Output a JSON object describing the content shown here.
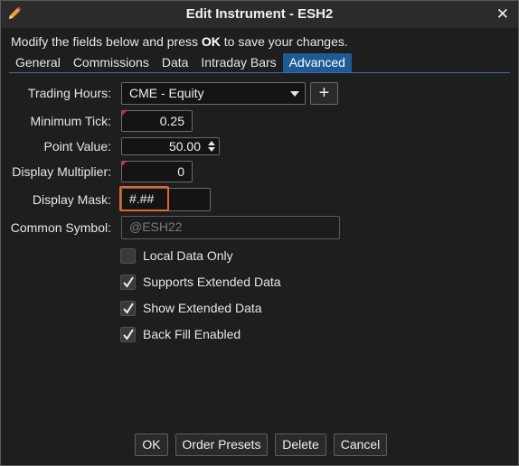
{
  "window": {
    "title": "Edit Instrument - ESH2",
    "close_glyph": "✕"
  },
  "instructions": {
    "before": "Modify the fields below and press ",
    "bold": "OK",
    "after": " to save your changes."
  },
  "tabs": [
    {
      "label": "General",
      "active": false
    },
    {
      "label": "Commissions",
      "active": false
    },
    {
      "label": "Data",
      "active": false
    },
    {
      "label": "Intraday Bars",
      "active": false
    },
    {
      "label": "Advanced",
      "active": true
    }
  ],
  "form": {
    "trading_hours": {
      "label": "Trading Hours:",
      "value": "CME - Equity"
    },
    "minimum_tick": {
      "label": "Minimum Tick:",
      "value": "0.25"
    },
    "point_value": {
      "label": "Point Value:",
      "value": "50.00"
    },
    "display_multiplier": {
      "label": "Display Multiplier:",
      "value": "0"
    },
    "display_mask": {
      "label": "Display Mask:",
      "value": "#.##"
    },
    "common_symbol": {
      "label": "Common Symbol:",
      "placeholder": "@ESH22"
    }
  },
  "add_button_glyph": "+",
  "checkboxes": [
    {
      "label": "Local Data Only",
      "checked": false
    },
    {
      "label": "Supports Extended Data",
      "checked": true
    },
    {
      "label": "Show Extended Data",
      "checked": true
    },
    {
      "label": "Back Fill Enabled",
      "checked": true
    }
  ],
  "buttons": {
    "ok": "OK",
    "order_presets": "Order Presets",
    "delete": "Delete",
    "cancel": "Cancel"
  },
  "colors": {
    "accent": "#1e5a96",
    "highlight": "#e8652a",
    "background": "#1e1e1e"
  }
}
